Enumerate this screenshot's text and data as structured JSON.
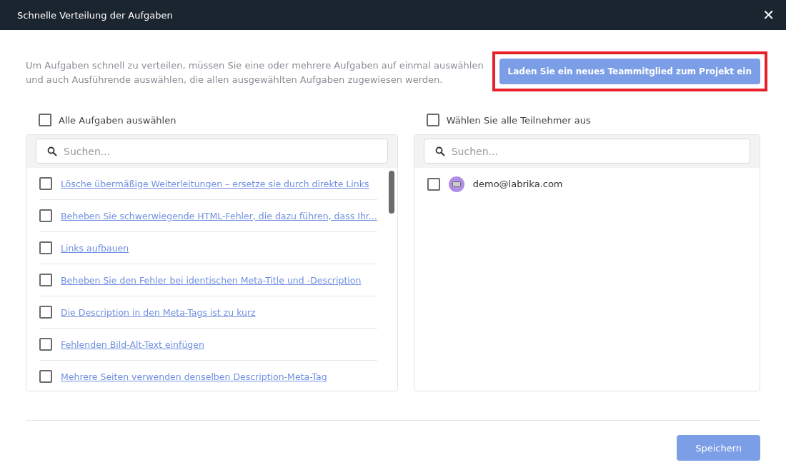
{
  "window": {
    "title": "Schnelle Verteilung der Aufgaben",
    "close": "✕"
  },
  "intro": "Um Aufgaben schnell zu verteilen, müssen Sie eine oder mehrere Aufgaben auf einmal auswählen und auch Ausführende auswählen, die allen ausgewählten Aufgaben zugewiesen werden.",
  "invite_button": {
    "label": "Laden Sie ein neues Teammitglied zum Projekt ein",
    "highlighted": true
  },
  "tasks_panel": {
    "select_all": {
      "label": "Alle Aufgaben auswählen",
      "checked": false
    },
    "search": {
      "placeholder": "Suchen..."
    },
    "items": [
      {
        "label": "Lösche übermäßige Weiterleitungen – ersetze sie durch direkte Links",
        "checked": false
      },
      {
        "label": "Beheben Sie schwerwiegende HTML-Fehler, die dazu führen, dass Ihr...",
        "checked": false
      },
      {
        "label": "Links aufbauen",
        "checked": false
      },
      {
        "label": "Beheben Sie den Fehler bei identischen Meta-Title und -Description",
        "checked": false
      },
      {
        "label": "Die Description in den Meta-Tags ist zu kurz",
        "checked": false
      },
      {
        "label": "Fehlenden Bild-Alt-Text einfügen",
        "checked": false
      },
      {
        "label": "Mehrere Seiten verwenden denselben Description-Meta-Tag",
        "checked": false
      }
    ]
  },
  "members_panel": {
    "select_all": {
      "label": "Wählen Sie alle Teilnehmer aus",
      "checked": false
    },
    "search": {
      "placeholder": "Suchen..."
    },
    "items": [
      {
        "label": "demo@labrika.com",
        "checked": false
      }
    ]
  },
  "save_button": "Speichern"
}
